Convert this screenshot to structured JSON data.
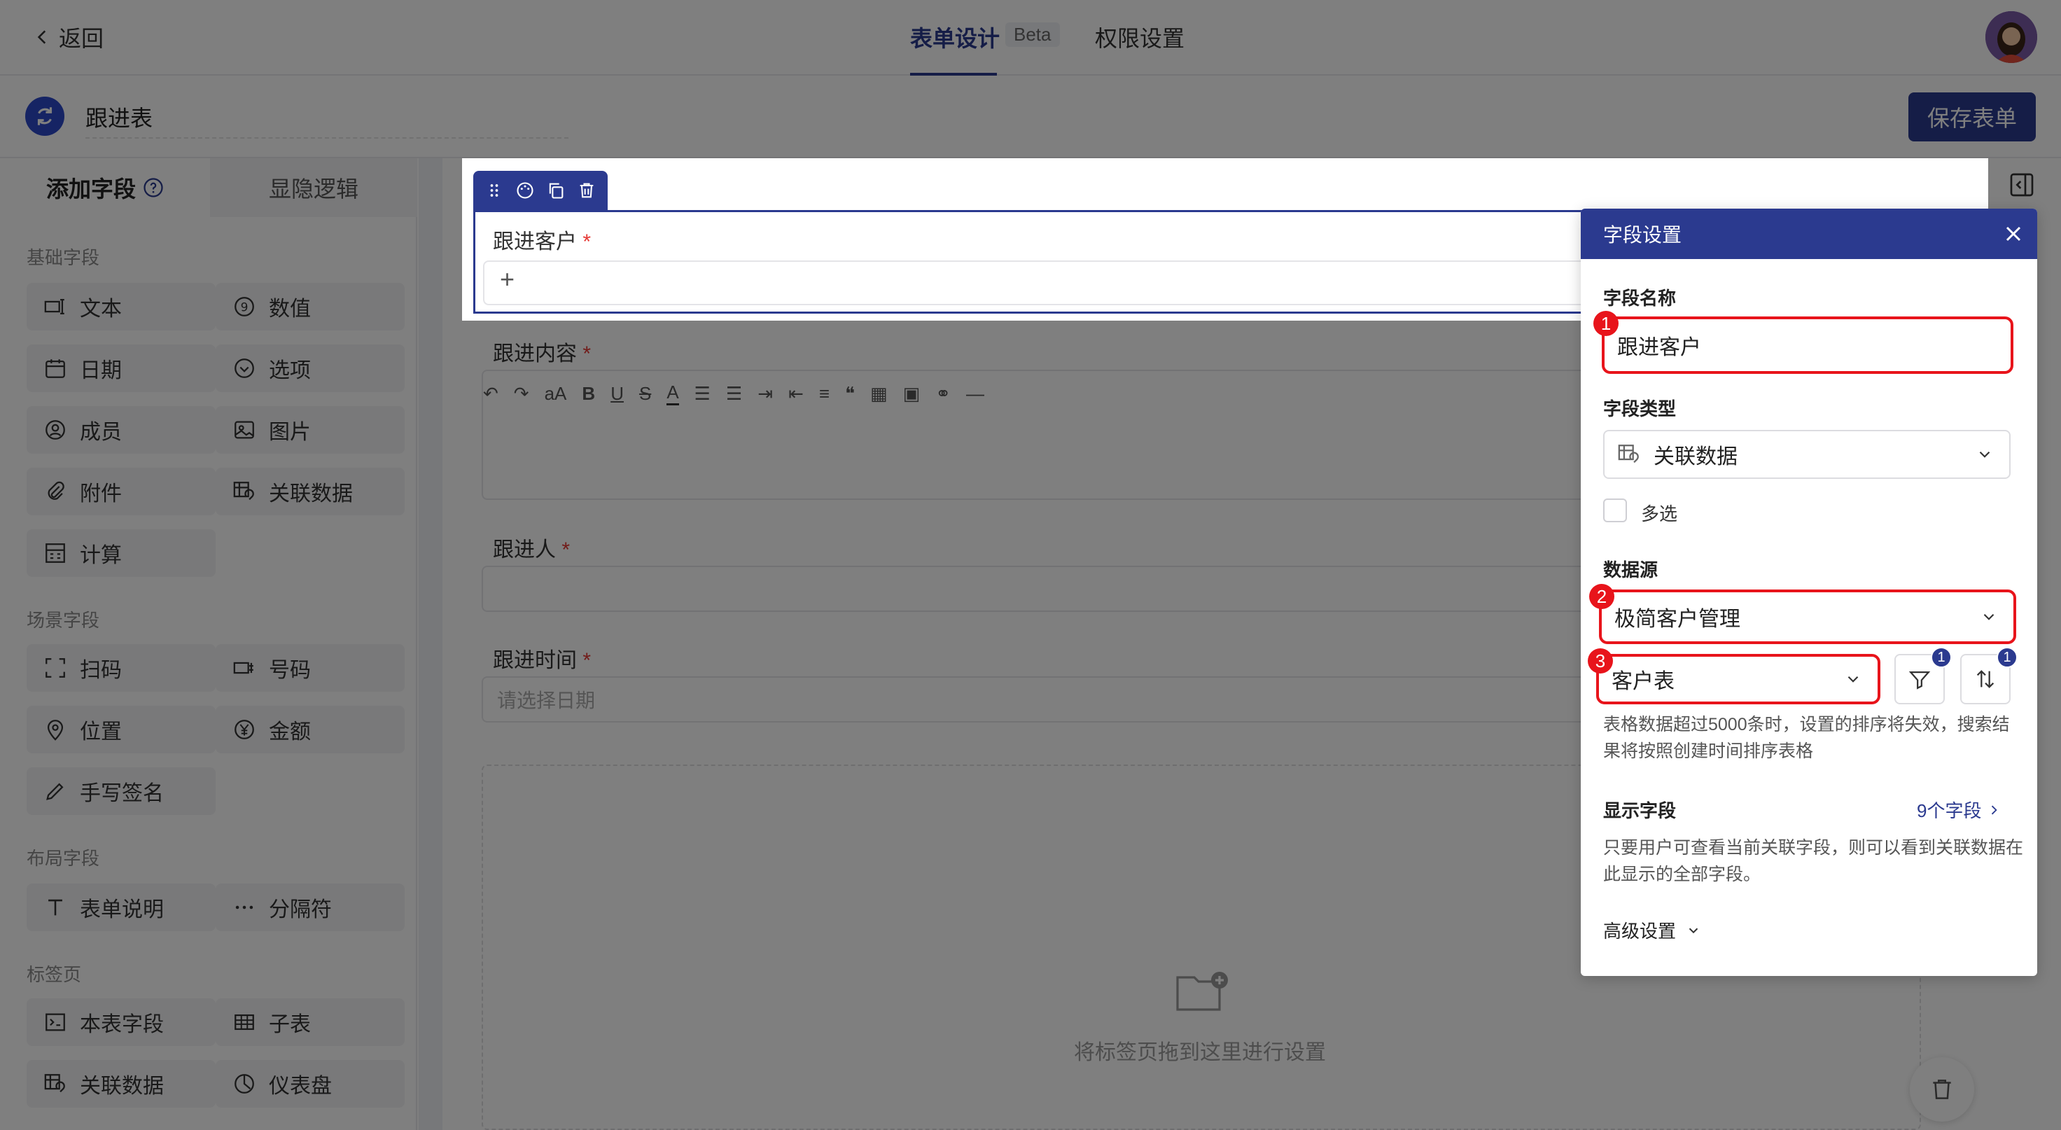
{
  "header": {
    "back_label": "返回",
    "tabs": [
      {
        "label": "表单设计",
        "badge": "Beta",
        "active": true
      },
      {
        "label": "权限设置",
        "active": false
      }
    ]
  },
  "form": {
    "name": "跟进表",
    "save_label": "保存表单"
  },
  "left_panel": {
    "tabs": [
      "添加字段",
      "显隐逻辑"
    ],
    "sections": [
      {
        "title": "基础字段",
        "items": [
          {
            "label": "文本",
            "icon": "text-icon"
          },
          {
            "label": "数值",
            "icon": "number-icon"
          },
          {
            "label": "日期",
            "icon": "calendar-icon"
          },
          {
            "label": "选项",
            "icon": "option-icon"
          },
          {
            "label": "成员",
            "icon": "member-icon"
          },
          {
            "label": "图片",
            "icon": "image-icon"
          },
          {
            "label": "附件",
            "icon": "paperclip-icon"
          },
          {
            "label": "关联数据",
            "icon": "linked-data-icon"
          },
          {
            "label": "计算",
            "icon": "calculator-icon"
          }
        ]
      },
      {
        "title": "场景字段",
        "items": [
          {
            "label": "扫码",
            "icon": "scan-icon"
          },
          {
            "label": "号码",
            "icon": "serial-number-icon"
          },
          {
            "label": "位置",
            "icon": "location-icon"
          },
          {
            "label": "金额",
            "icon": "currency-icon"
          },
          {
            "label": "手写签名",
            "icon": "signature-icon"
          }
        ]
      },
      {
        "title": "布局字段",
        "items": [
          {
            "label": "表单说明",
            "icon": "text-t-icon"
          },
          {
            "label": "分隔符",
            "icon": "ellipsis-icon"
          }
        ]
      },
      {
        "title": "标签页",
        "items": [
          {
            "label": "本表字段",
            "icon": "form-field-icon"
          },
          {
            "label": "子表",
            "icon": "table-icon"
          },
          {
            "label": "关联数据",
            "icon": "linked-data-icon"
          },
          {
            "label": "仪表盘",
            "icon": "dashboard-icon"
          }
        ]
      }
    ]
  },
  "canvas": {
    "fields": [
      {
        "label": "跟进客户",
        "required": true,
        "input": "+"
      },
      {
        "label": "跟进内容",
        "required": true
      },
      {
        "label": "跟进人",
        "required": true
      },
      {
        "label": "跟进时间",
        "required": true,
        "placeholder": "请选择日期"
      }
    ],
    "tab_drop_hint": "将标签页拖到这里进行设置"
  },
  "settings": {
    "title": "字段设置",
    "name_label": "字段名称",
    "name_value": "跟进客户",
    "type_label": "字段类型",
    "type_value": "关联数据",
    "multi_label": "多选",
    "source_label": "数据源",
    "source_app": "极简客户管理",
    "source_table": "客户表",
    "filter_count": "1",
    "sort_count": "1",
    "sort_note": "表格数据超过5000条时，设置的排序将失效，搜索结果将按照创建时间排序表格",
    "display_label": "显示字段",
    "display_link": "9个字段",
    "display_note": "只要用户可查看当前关联字段，则可以看到关联数据在此显示的全部字段。",
    "advanced_label": "高级设置",
    "step_badges": [
      "1",
      "2",
      "3"
    ]
  },
  "colors": {
    "primary": "#2b3a8f",
    "highlight": "#e8141b",
    "required": "#e53935"
  }
}
